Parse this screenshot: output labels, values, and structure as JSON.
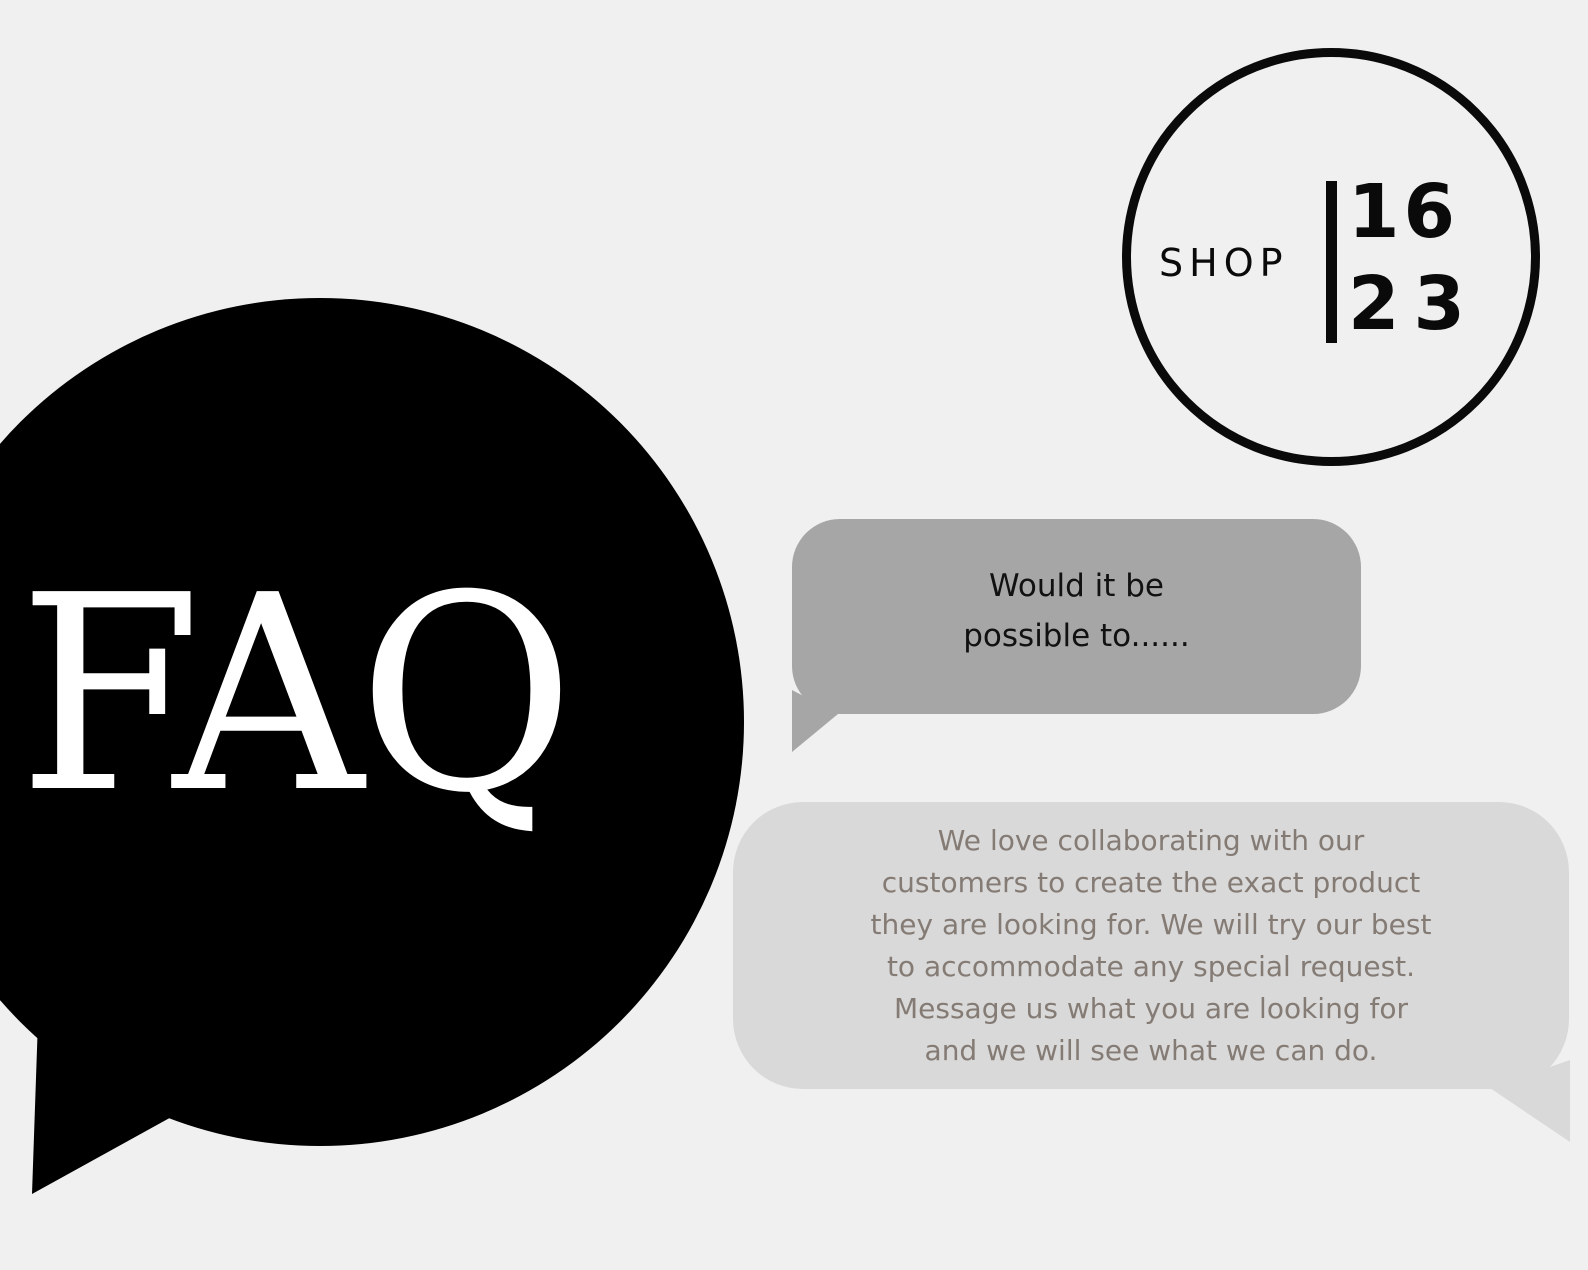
{
  "faq": {
    "title": "FAQ"
  },
  "logo": {
    "shop": "SHOP",
    "top_number": "16",
    "bottom_number": "23"
  },
  "question": {
    "line1": "Would it be",
    "line2": "possible to......"
  },
  "answer": {
    "lines": [
      "We love collaborating with our",
      "customers to create the exact product",
      "they are looking for. We will try our best",
      "to accommodate any special request.",
      "Message us what you are looking for",
      "and we will see what we can do."
    ]
  },
  "colors": {
    "background": "#f0f0f0",
    "faq_bubble": "#000000",
    "question_bubble": "#a6a6a6",
    "answer_bubble": "#d9d9d9",
    "answer_text": "#857b75"
  }
}
